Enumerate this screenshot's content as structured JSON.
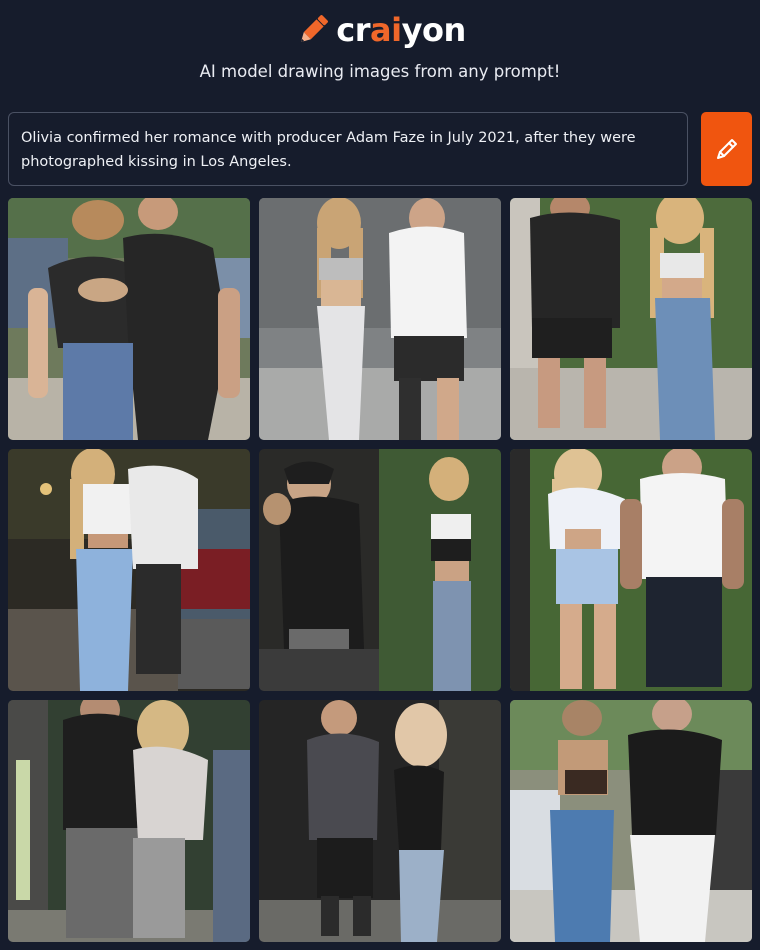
{
  "brand": {
    "name_prefix": "cr",
    "name_accent": "ai",
    "name_suffix": "yon",
    "accent_color": "#f0672a",
    "logo_icon": "pencil-icon"
  },
  "tagline": "AI model drawing images from any prompt!",
  "prompt": {
    "value": "Olivia confirmed her romance with producer Adam Faze in July 2021, after they were photographed kissing in Los Angeles."
  },
  "draw_button": {
    "icon": "pencil-icon",
    "color": "#f0550f"
  },
  "results": [
    {
      "id": 1,
      "bg": "#5a6b4a"
    },
    {
      "id": 2,
      "bg": "#8c8f93"
    },
    {
      "id": 3,
      "bg": "#4f6b3e"
    },
    {
      "id": 4,
      "bg": "#3a3a32"
    },
    {
      "id": 5,
      "bg": "#36453a"
    },
    {
      "id": 6,
      "bg": "#4a6a3a"
    },
    {
      "id": 7,
      "bg": "#2f3a30"
    },
    {
      "id": 8,
      "bg": "#2a2a2a"
    },
    {
      "id": 9,
      "bg": "#8a8a80"
    }
  ]
}
